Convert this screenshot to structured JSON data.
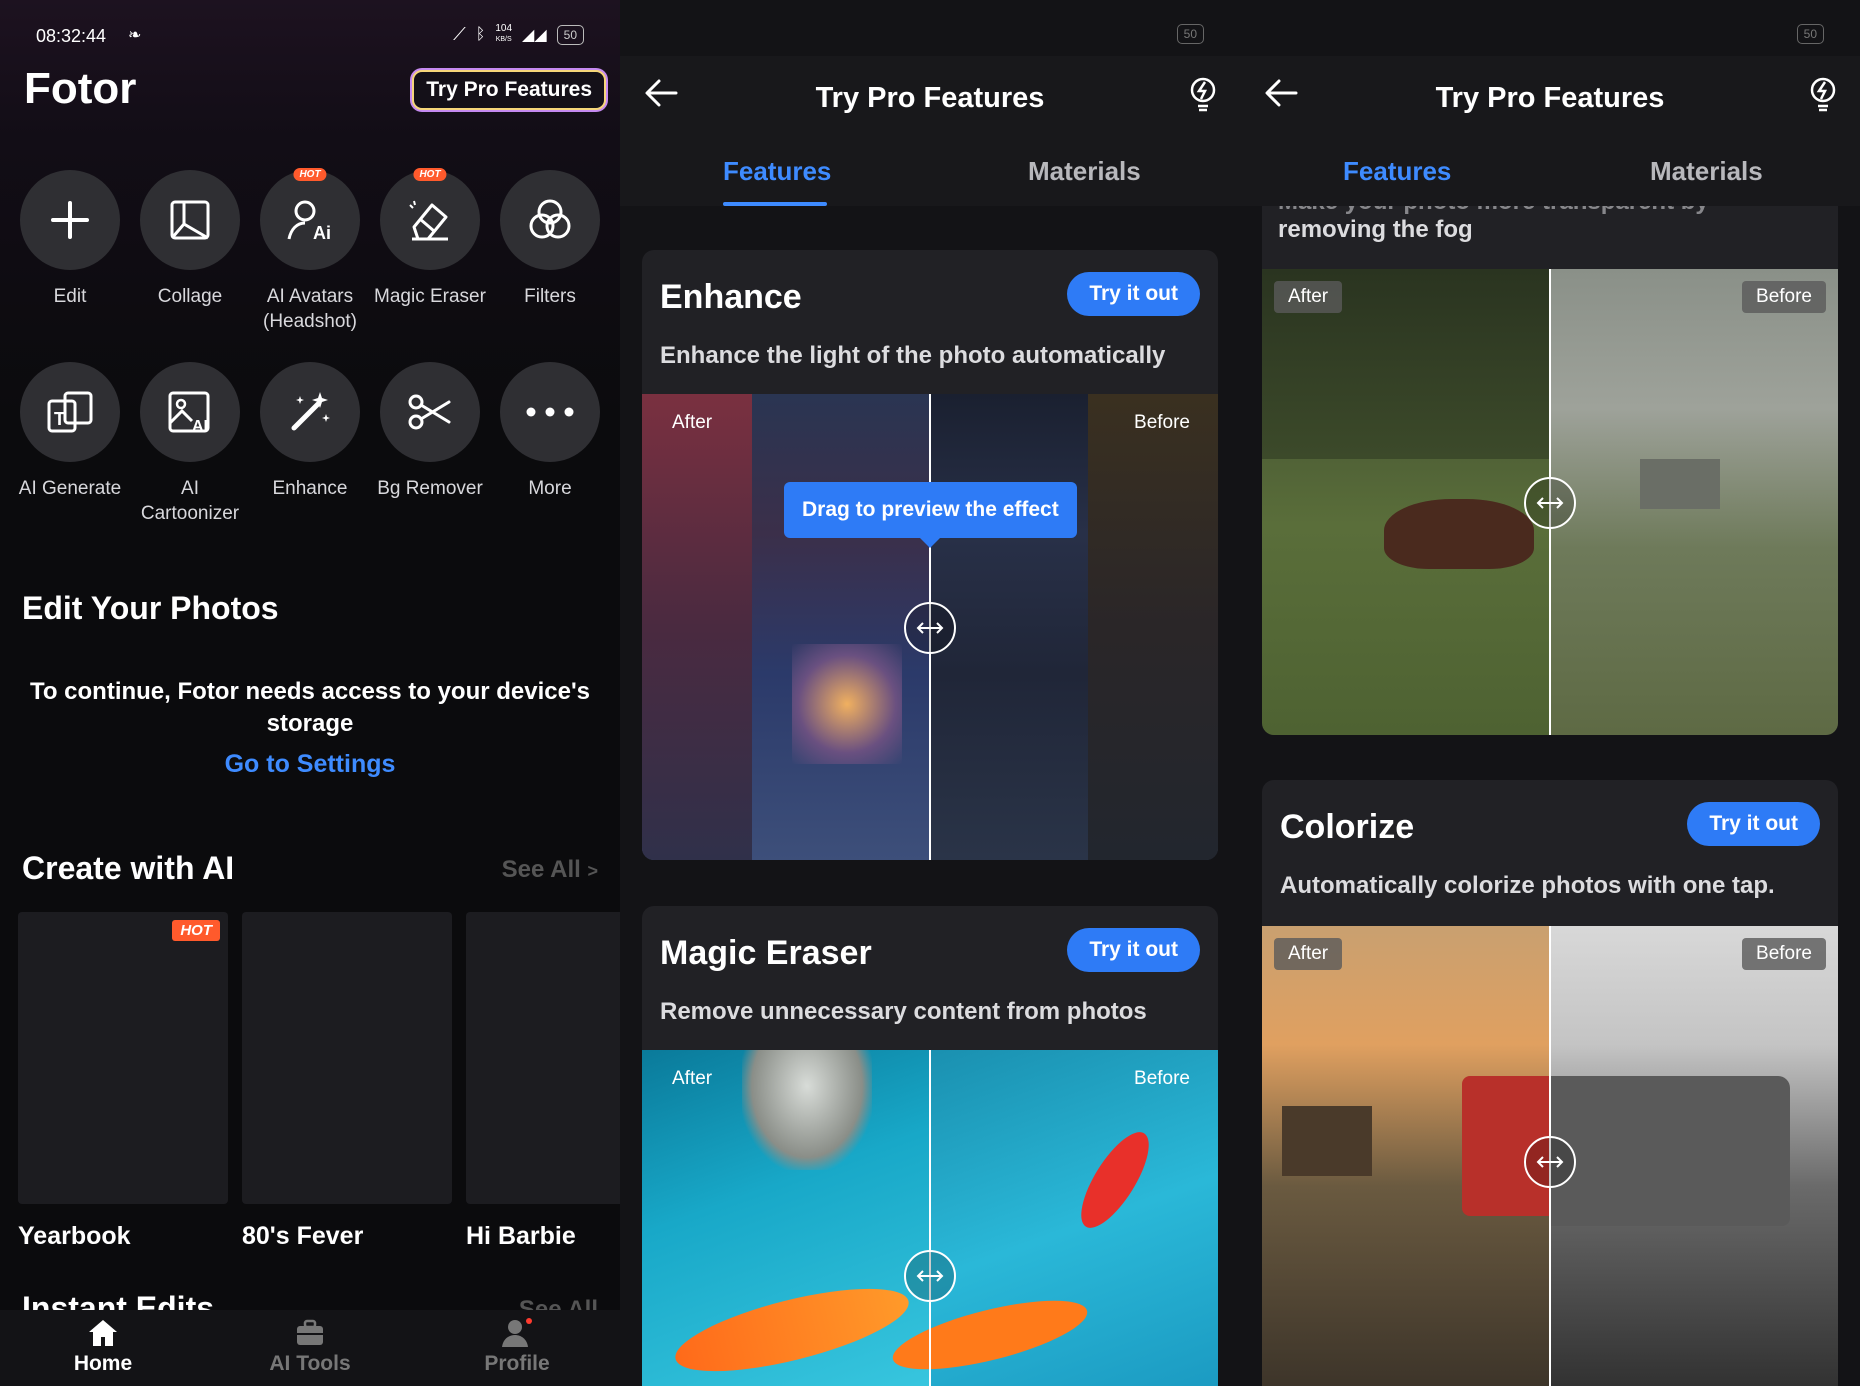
{
  "status": {
    "time": "08:32:44",
    "net_speed_value": "104",
    "net_speed_unit": "KB/S",
    "battery": "50"
  },
  "home": {
    "brand": "Fotor",
    "pro_button": "Try Pro Features",
    "tools": [
      {
        "label": "Edit",
        "icon": "plus-icon",
        "hot": false
      },
      {
        "label": "Collage",
        "icon": "collage-icon",
        "hot": false
      },
      {
        "label": "AI Avatars (Headshot)",
        "icon": "ai-avatar-icon",
        "hot": true
      },
      {
        "label": "Magic Eraser",
        "icon": "eraser-icon",
        "hot": true
      },
      {
        "label": "Filters",
        "icon": "filters-icon",
        "hot": false
      },
      {
        "label": "AI Generate",
        "icon": "ai-generate-icon",
        "hot": false
      },
      {
        "label": "AI Cartoonizer",
        "icon": "ai-cartoonizer-icon",
        "hot": false
      },
      {
        "label": "Enhance",
        "icon": "magic-wand-icon",
        "hot": false
      },
      {
        "label": "Bg Remover",
        "icon": "scissors-icon",
        "hot": false
      },
      {
        "label": "More",
        "icon": "more-dots-icon",
        "hot": false
      }
    ],
    "hot_badge": "HOT",
    "edit_section_title": "Edit Your Photos",
    "storage_notice": "To continue, Fotor needs access to your device's storage",
    "settings_link": "Go to Settings",
    "create_ai_title": "Create with AI",
    "see_all": "See All",
    "ai_cards": [
      {
        "title": "Yearbook",
        "hot": true
      },
      {
        "title": "80's Fever",
        "hot": false
      },
      {
        "title": "Hi Barbie",
        "hot": false
      }
    ],
    "instant_edits_title": "Instant Edits",
    "nav": [
      {
        "label": "Home",
        "icon": "home-icon",
        "active": true
      },
      {
        "label": "AI Tools",
        "icon": "toolbox-icon",
        "active": false
      },
      {
        "label": "Profile",
        "icon": "profile-icon",
        "active": false
      }
    ]
  },
  "pro": {
    "title": "Try Pro Features",
    "tabs": [
      "Features",
      "Materials"
    ],
    "try_label": "Try it out",
    "after_label": "After",
    "before_label": "Before",
    "drag_hint": "Drag to preview the effect",
    "features": [
      {
        "name": "Enhance",
        "desc": "Enhance the light of the photo automatically"
      },
      {
        "name": "Magic Eraser",
        "desc": "Remove unnecessary content from photos"
      },
      {
        "name": "Colorize",
        "desc": "Automatically colorize photos with one tap."
      }
    ],
    "defog_partial_top": "Make your photo more transparent by",
    "defog_partial": "removing the fog"
  },
  "colors": {
    "accent": "#2e7bf6",
    "link": "#3e8bff",
    "hot": "#ff5a2c"
  }
}
